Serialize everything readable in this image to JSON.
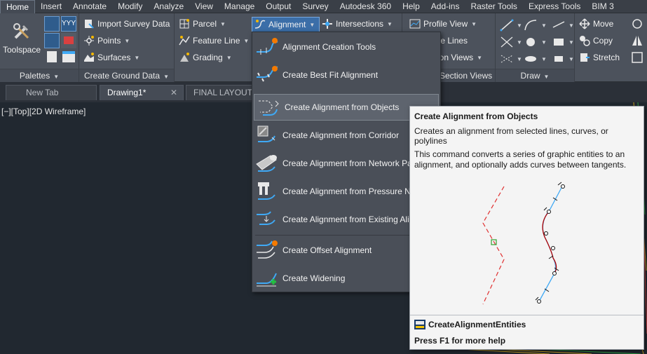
{
  "menu_tabs": [
    "Home",
    "Insert",
    "Annotate",
    "Modify",
    "Analyze",
    "View",
    "Manage",
    "Output",
    "Survey",
    "Autodesk 360",
    "Help",
    "Add-ins",
    "Raster Tools",
    "Express Tools",
    "BIM 3"
  ],
  "active_tab": "Home",
  "ribbon": {
    "toolspace_label": "Toolspace",
    "palettes_title": "Palettes",
    "ground": {
      "import_survey": "Import Survey Data",
      "points": "Points",
      "surfaces": "Surfaces",
      "title": "Create Ground Data"
    },
    "design": {
      "parcel": "Parcel",
      "feature_line": "Feature Line",
      "grading": "Grading",
      "alignment": "Alignment",
      "intersections": "Intersections"
    },
    "profile": {
      "profile_view": "Profile View",
      "sample_lines": "ple Lines",
      "section_views": "ion Views",
      "section_views2": "Section Views"
    },
    "draw_title": "Draw",
    "modify": {
      "move": "Move",
      "copy": "Copy",
      "stretch": "Stretch"
    }
  },
  "doc_tabs": [
    "New Tab",
    "Drawing1*",
    "FINAL LAYOUT"
  ],
  "viewport_label": "[−][Top][2D Wireframe]",
  "dropdown_items": [
    "Alignment Creation Tools",
    "Create Best Fit Alignment",
    "Create Alignment from Objects",
    "Create Alignment from Corridor",
    "Create Alignment from Network Pa",
    "Create Alignment from Pressure Ne",
    "Create Alignment from Existing Alig",
    "Create Offset Alignment",
    "Create Widening"
  ],
  "highlighted_item": "Create Alignment from Objects",
  "tooltip": {
    "title": "Create Alignment from Objects",
    "subtitle": "Creates an alignment from selected lines, curves, or polylines",
    "body": "This command converts a series of graphic entities to an alignment, and optionally adds curves between tangents.",
    "command": "CreateAlignmentEntities",
    "help": "Press F1 for more help"
  },
  "colors": {
    "accent_blue": "#3fa9f5",
    "dashed_red": "#e03030",
    "curve_red": "#b00000",
    "viewport_bg": "#212830"
  }
}
